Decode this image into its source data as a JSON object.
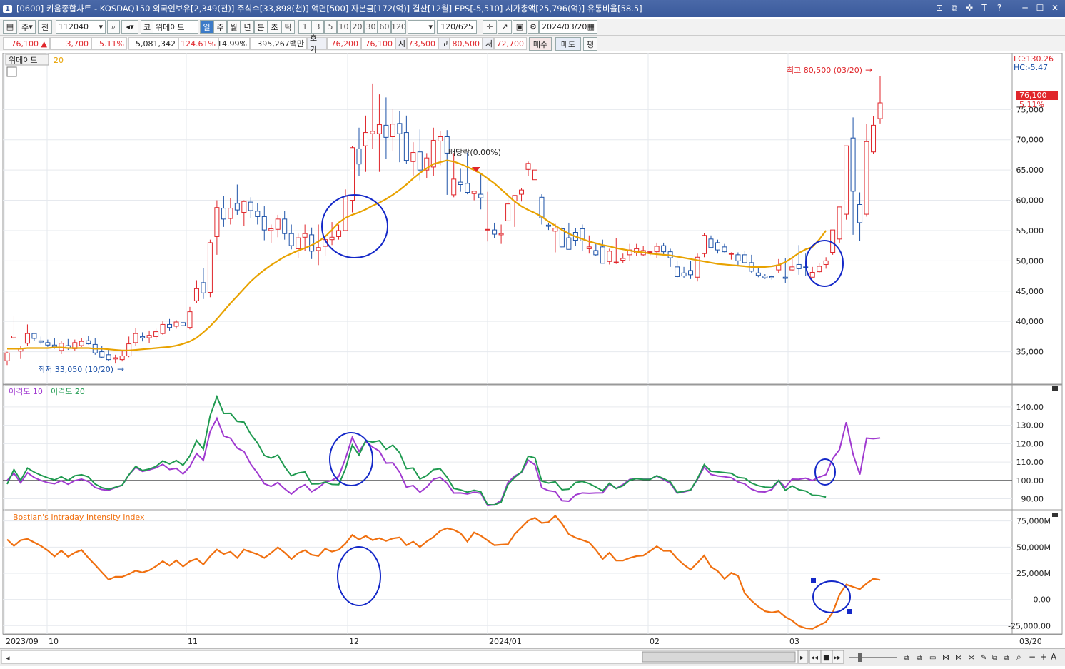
{
  "window": {
    "number": "1",
    "title": "[0600] 키움종합차트 - KOSDAQ150 외국인보유[2,349(천)] 주식수[33,898(천)] 액면[500] 자본금[172(억)] 결산[12월] EPS[-5,510] 시가총액[25,796(억)] 유통비율[58.5]"
  },
  "toolbar": {
    "period_mode": "주",
    "whole_btn": "전",
    "code": "112040",
    "market_tag": "코",
    "stock_name": "위메이드",
    "period_tabs": [
      "일",
      "주",
      "월",
      "년",
      "분",
      "초",
      "틱"
    ],
    "selected_tab": "일",
    "minute_tabs": [
      "1",
      "3",
      "5",
      "10",
      "20",
      "30",
      "60",
      "120"
    ],
    "count": "120",
    "count_total": "/625",
    "date": "2024/03/20"
  },
  "quote": {
    "price": "76,100",
    "change": "3,700",
    "change_pct": "+5.11%",
    "volume": "5,081,342",
    "vol_ratio": "124.61%",
    "turnover": "14.99%",
    "amount": "395,267백만",
    "hoga_label": "호가",
    "ask": "76,200",
    "bid": "76,100",
    "open_label": "시",
    "open": "73,500",
    "high_label": "고",
    "high": "80,500",
    "low_label": "저",
    "low": "72,700",
    "buy_btn": "매수",
    "sell_btn": "매도",
    "eval_btn": "평"
  },
  "chart_data": [
    {
      "type": "candlestick",
      "title": "위메이드",
      "ma_label": "20",
      "ylim": [
        30000,
        84000
      ],
      "yticks": [
        "35,000",
        "40,000",
        "45,000",
        "50,000",
        "55,000",
        "60,000",
        "65,000",
        "70,000",
        "75,000"
      ],
      "lc_label": "LC:130.26",
      "hc_label": "HC:-5.47",
      "last_price_label": "76,100",
      "last_pct_label": "5.11%",
      "high_annotation": "최고 80,500 (03/20)",
      "low_annotation": "최저 33,050 (10/20)",
      "dividend_annotation": "배당락(0.00%)",
      "candles": [
        [
          33500,
          35000,
          32800,
          34800
        ],
        [
          37300,
          41000,
          37000,
          37600
        ],
        [
          35100,
          35900,
          33800,
          35500
        ],
        [
          36400,
          39500,
          36000,
          38000
        ],
        [
          38000,
          38100,
          36800,
          37200
        ],
        [
          36800,
          37500,
          36200,
          36600
        ],
        [
          36500,
          37000,
          35800,
          36100
        ],
        [
          36100,
          37200,
          35500,
          35800
        ],
        [
          35200,
          36800,
          34600,
          36400
        ],
        [
          36000,
          37100,
          35300,
          35600
        ],
        [
          35500,
          37000,
          35200,
          36500
        ],
        [
          36000,
          37200,
          35800,
          36700
        ],
        [
          36800,
          37600,
          36200,
          36300
        ],
        [
          36200,
          37200,
          34500,
          34800
        ],
        [
          35000,
          36000,
          33900,
          34100
        ],
        [
          34500,
          35500,
          33500,
          33700
        ],
        [
          33800,
          34500,
          33050,
          34000
        ],
        [
          33700,
          35200,
          33400,
          34300
        ],
        [
          34300,
          37500,
          34100,
          36300
        ],
        [
          36500,
          38900,
          36000,
          38000
        ],
        [
          37500,
          38200,
          36700,
          37300
        ],
        [
          37300,
          38500,
          36400,
          37700
        ],
        [
          37500,
          38800,
          37000,
          38300
        ],
        [
          38000,
          40000,
          37800,
          39500
        ],
        [
          39500,
          40400,
          38500,
          39000
        ],
        [
          39200,
          40200,
          38800,
          39900
        ],
        [
          39800,
          40800,
          39000,
          39300
        ],
        [
          39000,
          42400,
          38700,
          41600
        ],
        [
          43400,
          46800,
          43000,
          45400
        ],
        [
          46400,
          48800,
          43700,
          44700
        ],
        [
          44800,
          53500,
          44000,
          53000
        ],
        [
          54000,
          60000,
          51000,
          58800
        ],
        [
          58700,
          60700,
          55600,
          56900
        ],
        [
          57000,
          60300,
          56000,
          58700
        ],
        [
          59500,
          62600,
          57600,
          58400
        ],
        [
          58000,
          60000,
          55700,
          59800
        ],
        [
          59700,
          60500,
          57000,
          58300
        ],
        [
          58200,
          59500,
          56000,
          57300
        ],
        [
          57300,
          59000,
          53400,
          55100
        ],
        [
          55000,
          56000,
          53000,
          55300
        ],
        [
          55200,
          57600,
          53900,
          56900
        ],
        [
          56900,
          58200,
          53500,
          54500
        ],
        [
          54500,
          56000,
          51900,
          52500
        ],
        [
          52000,
          54500,
          50500,
          53800
        ],
        [
          53900,
          56000,
          51600,
          54500
        ],
        [
          54300,
          55500,
          50300,
          51600
        ],
        [
          51700,
          56000,
          49300,
          52200
        ],
        [
          52400,
          53800,
          50800,
          53500
        ],
        [
          53500,
          56400,
          52600,
          53900
        ],
        [
          54000,
          56000,
          53500,
          55000
        ],
        [
          55000,
          61800,
          55000,
          60700
        ],
        [
          60000,
          69000,
          58000,
          68700
        ],
        [
          68500,
          72000,
          64000,
          66000
        ],
        [
          69000,
          74000,
          64700,
          71200
        ],
        [
          71000,
          79300,
          68500,
          71400
        ],
        [
          71000,
          77500,
          64700,
          72500
        ],
        [
          72400,
          77000,
          66900,
          70400
        ],
        [
          70500,
          75100,
          68200,
          72600
        ],
        [
          72700,
          74800,
          66300,
          71000
        ],
        [
          71200,
          74000,
          66000,
          66600
        ],
        [
          66400,
          69600,
          64000,
          67900
        ],
        [
          68000,
          71700,
          63300,
          65000
        ],
        [
          65000,
          67800,
          63600,
          67000
        ],
        [
          65500,
          72000,
          64000,
          69900
        ],
        [
          69800,
          71400,
          65800,
          70500
        ],
        [
          70500,
          71600,
          60900,
          67800
        ],
        [
          60900,
          67800,
          60500,
          63500
        ],
        [
          63000,
          65200,
          61400,
          62600
        ],
        [
          62800,
          67900,
          61000,
          61300
        ],
        [
          61100,
          61500,
          60000,
          61500
        ],
        [
          61000,
          64500,
          58500,
          60400
        ],
        [
          55100,
          61400,
          53200,
          55200
        ],
        [
          55100,
          56300,
          53800,
          54400
        ],
        [
          54300,
          56000,
          52800,
          54500
        ],
        [
          56600,
          60800,
          57900,
          59400
        ],
        [
          59900,
          60500,
          55600,
          60800
        ],
        [
          61000,
          62000,
          59800,
          61700
        ],
        [
          65100,
          66400,
          64000,
          66100
        ],
        [
          63400,
          67300,
          60700,
          65000
        ],
        [
          60500,
          61000,
          56000,
          57100
        ],
        [
          55900,
          56200,
          55100,
          55700
        ],
        [
          54900,
          56100,
          51400,
          55400
        ],
        [
          55300,
          55600,
          52100,
          52300
        ],
        [
          53800,
          56300,
          52200,
          51900
        ],
        [
          54700,
          55400,
          52500,
          53400
        ],
        [
          55300,
          56000,
          51700,
          53300
        ],
        [
          52000,
          54200,
          51200,
          52300
        ],
        [
          51700,
          53000,
          50800,
          51000
        ],
        [
          52300,
          53500,
          49600,
          49600
        ],
        [
          49900,
          52000,
          49400,
          51600
        ],
        [
          49800,
          53700,
          49500,
          49800
        ],
        [
          50100,
          51200,
          49600,
          50400
        ],
        [
          51000,
          52800,
          50000,
          51800
        ],
        [
          51300,
          52800,
          50800,
          52000
        ],
        [
          51000,
          52500,
          50800,
          51700
        ],
        [
          51500,
          51700,
          50900,
          51500
        ],
        [
          51500,
          53000,
          50500,
          52400
        ],
        [
          52500,
          53000,
          51000,
          51500
        ],
        [
          51500,
          52000,
          49000,
          50500
        ],
        [
          49000,
          50000,
          47200,
          47400
        ],
        [
          48000,
          49000,
          47200,
          47500
        ],
        [
          48400,
          50000,
          47000,
          47700
        ],
        [
          47300,
          51200,
          46600,
          50600
        ],
        [
          51200,
          54600,
          50600,
          54200
        ],
        [
          53600,
          54200,
          52400,
          52200
        ],
        [
          53000,
          53500,
          51200,
          51800
        ],
        [
          52300,
          52800,
          51400,
          51500
        ],
        [
          51200,
          51400,
          50200,
          51200
        ],
        [
          51000,
          51400,
          49300,
          50000
        ],
        [
          51000,
          51600,
          50300,
          49700
        ],
        [
          49700,
          51000,
          48000,
          48300
        ],
        [
          48000,
          49000,
          47300,
          47600
        ],
        [
          47500,
          47800,
          47000,
          47200
        ],
        [
          47400,
          47600,
          46900,
          47200
        ],
        [
          48500,
          50300,
          48000,
          49300
        ],
        [
          47300,
          50500,
          46300,
          47100
        ],
        [
          48500,
          50400,
          48400,
          49000
        ],
        [
          49400,
          52600,
          47700,
          48700
        ],
        [
          49000,
          51200,
          47500,
          48900
        ],
        [
          47300,
          49000,
          47300,
          48100
        ],
        [
          48200,
          49600,
          48000,
          49100
        ],
        [
          49400,
          50600,
          48700,
          50000
        ],
        [
          51400,
          55000,
          51000,
          55100
        ],
        [
          53600,
          57000,
          53000,
          58900
        ],
        [
          57700,
          68400,
          56800,
          69000
        ],
        [
          70300,
          73700,
          54300,
          61500
        ],
        [
          59300,
          61300,
          53300,
          56300
        ],
        [
          57700,
          72600,
          57300,
          69700
        ],
        [
          68000,
          73900,
          67700,
          72400
        ],
        [
          73500,
          80500,
          72700,
          76100
        ]
      ],
      "ma20": [
        35500,
        35500,
        35500,
        35600,
        35600,
        35600,
        35600,
        35700,
        35700,
        35600,
        35600,
        35600,
        35600,
        35500,
        35500,
        35400,
        35300,
        35200,
        35200,
        35300,
        35400,
        35500,
        35600,
        35700,
        35800,
        36000,
        36300,
        36700,
        37300,
        38200,
        39200,
        40400,
        41700,
        43000,
        44200,
        45400,
        46600,
        47600,
        48500,
        49300,
        50000,
        50700,
        51200,
        51700,
        52100,
        52600,
        53200,
        54000,
        55100,
        56300,
        57100,
        57600,
        58000,
        58500,
        59100,
        59600,
        60200,
        60900,
        61700,
        62600,
        63600,
        64500,
        65300,
        66000,
        66300,
        66600,
        66400,
        66000,
        65500,
        65000,
        64400,
        63600,
        62800,
        61800,
        60800,
        59800,
        59000,
        58400,
        57900,
        57300,
        56500,
        55800,
        55100,
        54500,
        54000,
        53600,
        53200,
        52900,
        52600,
        52400,
        52100,
        51900,
        51700,
        51500,
        51400,
        51200,
        51100,
        51000,
        50900,
        50700,
        50500,
        50300,
        50100,
        49900,
        49700,
        49500,
        49400,
        49300,
        49200,
        49100,
        49000,
        49000,
        49000,
        49100,
        49300,
        49800,
        50500,
        51300,
        51900,
        52300,
        53500,
        55000
      ]
    },
    {
      "type": "line",
      "title": "이격도",
      "series_labels": [
        "이격도 10",
        "이격도 20"
      ],
      "yticks": [
        "90.00",
        "100.00",
        "110.00",
        "120.00",
        "130.00",
        "140.00"
      ],
      "ylim": [
        84,
        152
      ],
      "baseline": 100,
      "series": [
        {
          "name": "이격도 10",
          "color": "#a03ad0"
        },
        {
          "name": "이격도 20",
          "color": "#1f9a50"
        }
      ]
    },
    {
      "type": "line",
      "title": "Bostian's Intraday Intensity Index",
      "yticks": [
        "-25,000.00",
        "0.00",
        "25,000M",
        "50,000M",
        "75,000M"
      ],
      "ylim": [
        -33,
        85
      ],
      "series": [
        {
          "name": "Bostian's Intraday Intensity Index",
          "color": "#f07010"
        }
      ]
    }
  ],
  "x_axis_labels": [
    "2023/09",
    "10",
    "11",
    "12",
    "2024/01",
    "02",
    "03",
    "03/20"
  ],
  "colors": {
    "up": "#e0262b",
    "down": "#1d52a8",
    "ma": "#e8a200",
    "circle": "#1428c8",
    "accent": "#3c7bc8"
  }
}
